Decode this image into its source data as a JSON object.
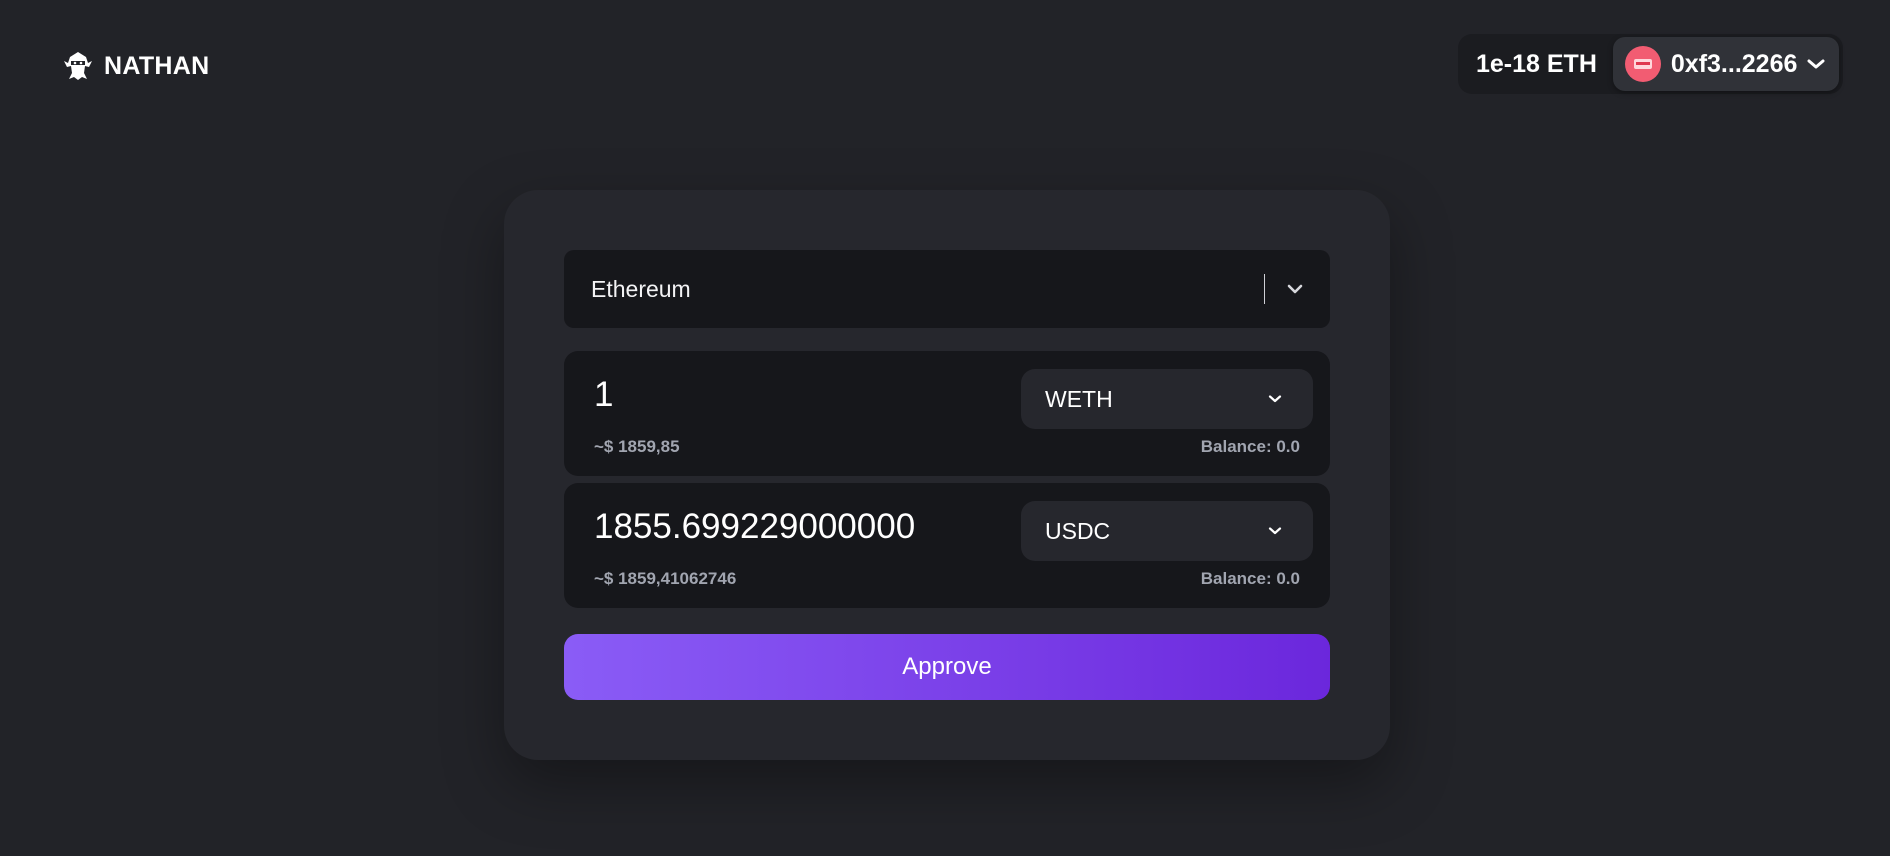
{
  "header": {
    "brand_name": "NATHAN",
    "brand_icon": "ninja-logo-icon",
    "wallet_balance": "1e-18 ETH",
    "account_address": "0xf3...2266",
    "avatar_color": "#f25c72"
  },
  "swap": {
    "network": {
      "selected": "Ethereum"
    },
    "from": {
      "amount": "1",
      "usd_value": "~$ 1859,85",
      "token": "WETH",
      "balance": "Balance: 0.0"
    },
    "to": {
      "amount": "1855.699229000000",
      "usd_value": "~$ 1859,41062746",
      "token": "USDC",
      "balance": "Balance: 0.0"
    },
    "action_label": "Approve",
    "accent_gradient": [
      "#8a5cf6",
      "#6b27dc"
    ]
  }
}
